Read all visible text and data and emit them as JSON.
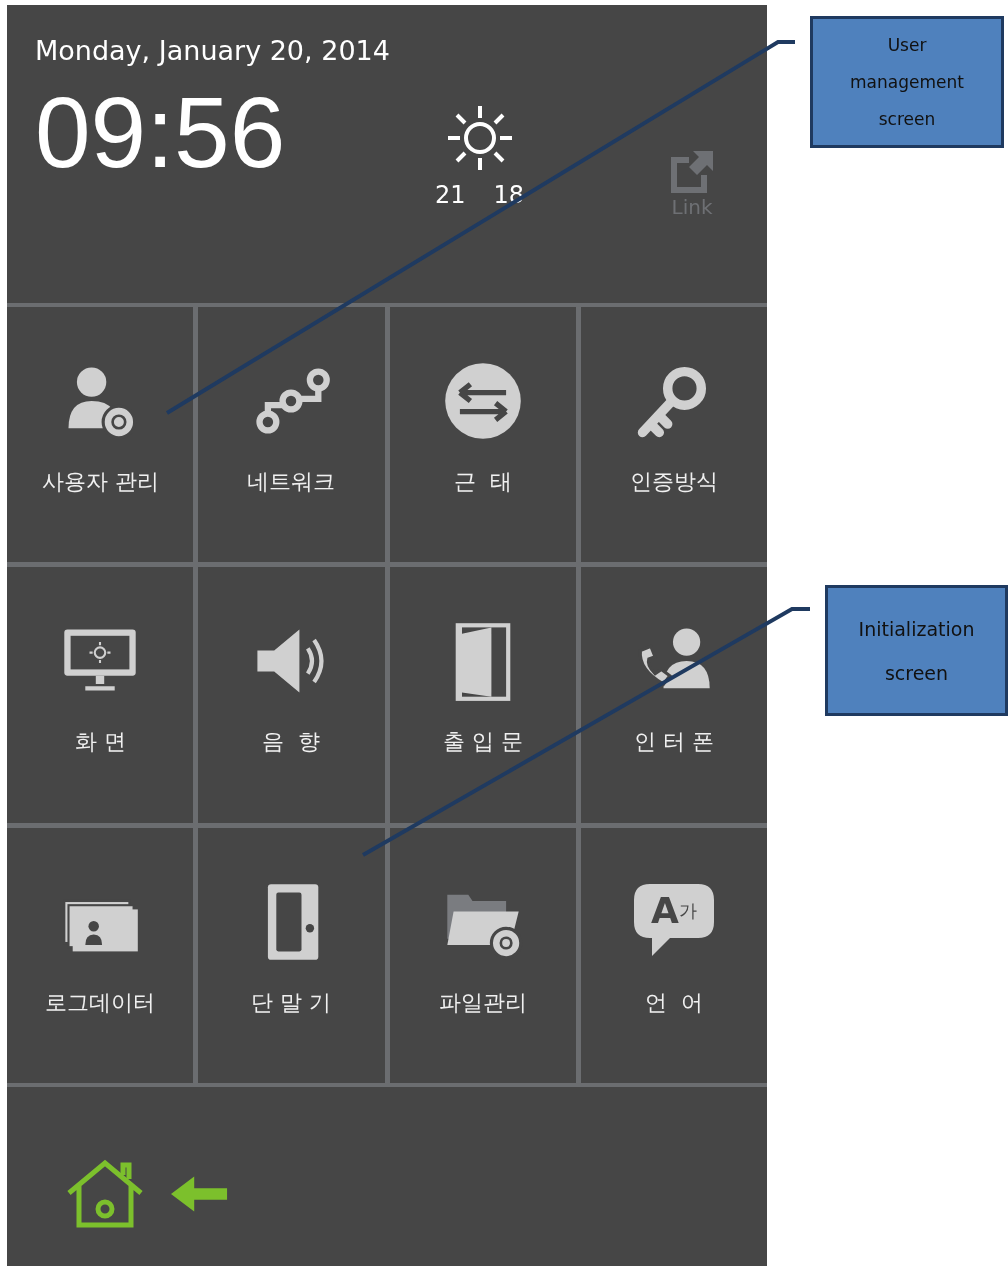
{
  "header": {
    "date": "Monday, January 20, 2014",
    "time": "09:56",
    "weather": {
      "high": "21",
      "low": "18"
    },
    "link": {
      "label": "Link",
      "disabled": true
    }
  },
  "tiles": [
    {
      "label": "사용자 관리"
    },
    {
      "label": "네트워크"
    },
    {
      "label": "근  태"
    },
    {
      "label": "인증방식"
    },
    {
      "label": "화 면"
    },
    {
      "label": "음  향"
    },
    {
      "label": "출 입 문"
    },
    {
      "label": "인 터 폰"
    },
    {
      "label": "로그데이터"
    },
    {
      "label": "단 말 기"
    },
    {
      "label": "파일관리"
    },
    {
      "label": "언  어",
      "icon_letters": [
        "A",
        "가"
      ]
    }
  ],
  "callouts": [
    {
      "text": "User management screen"
    },
    {
      "text": "Initialization screen"
    }
  ]
}
